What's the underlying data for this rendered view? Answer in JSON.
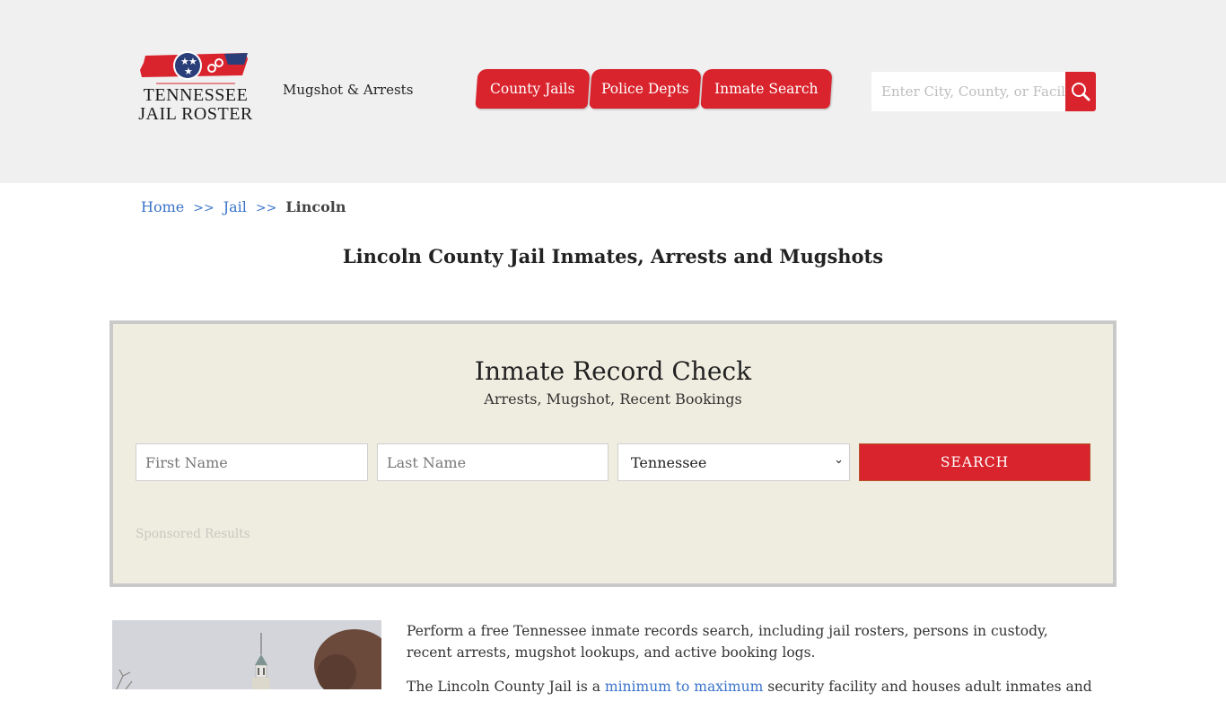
{
  "header": {
    "logo_line1": "TENNESSEE",
    "logo_line2": "JAIL ROSTER",
    "tagline": "Mugshot & Arrests",
    "nav": [
      {
        "label": "County Jails"
      },
      {
        "label": "Police Depts"
      },
      {
        "label": "Inmate Search"
      }
    ],
    "search": {
      "placeholder": "Enter City, County, or Facility",
      "value": "",
      "icon": "search-icon"
    }
  },
  "breadcrumb": {
    "home": "Home",
    "sep": ">>",
    "jail": "Jail",
    "current": "Lincoln"
  },
  "page_title": "Lincoln County Jail Inmates, Arrests and Mugshots",
  "record_check": {
    "title": "Inmate Record Check",
    "subtitle": "Arrests, Mugshot, Recent Bookings",
    "first_name_placeholder": "First Name",
    "last_name_placeholder": "Last Name",
    "state_selected": "Tennessee",
    "search_label": "SEARCH",
    "sponsored": "Sponsored Results"
  },
  "content": {
    "para1": "Perform a free Tennessee inmate records search, including jail rosters, persons in custody, recent arrests, mugshot lookups, and active booking logs.",
    "para2_start": "The Lincoln County Jail is a ",
    "para2_link": "minimum to maximum",
    "para2_end": " security facility and houses adult inmates and"
  },
  "colors": {
    "brand_red": "#d9232d",
    "link_blue": "#3a73c9",
    "box_bg": "#efede0",
    "header_bg": "#f0f0f0"
  }
}
